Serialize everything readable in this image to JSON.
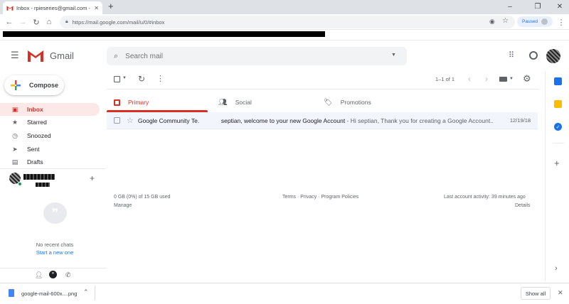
{
  "browser": {
    "tab_title": "Inbox - rpieseries@gmail.com - G",
    "url": "https://mail.google.com/mail/u/0/#inbox",
    "profile_status": "Paused",
    "new_tab_label": "+"
  },
  "gmail": {
    "logo_text": "Gmail",
    "search_placeholder": "Search mail",
    "compose_label": "Compose",
    "nav": [
      {
        "label": "Inbox",
        "icon": "inbox-icon"
      },
      {
        "label": "Starred",
        "icon": "star-icon"
      },
      {
        "label": "Snoozed",
        "icon": "clock-icon"
      },
      {
        "label": "Sent",
        "icon": "send-icon"
      },
      {
        "label": "Drafts",
        "icon": "draft-icon"
      }
    ],
    "hangouts": {
      "no_recent": "No recent chats",
      "start_new": "Start a new one"
    },
    "toolbar": {
      "pagination": "1–1 of 1"
    },
    "categories": [
      {
        "label": "Primary",
        "icon": "inbox-tab-icon"
      },
      {
        "label": "Social",
        "icon": "people-icon"
      },
      {
        "label": "Promotions",
        "icon": "tag-icon"
      }
    ],
    "emails": [
      {
        "sender": "Google Community Te.",
        "subject": "septian, welcome to your new Google Account",
        "snippet": " - Hi septian, Thank you for creating a Google Account...",
        "date": "12/19/18"
      }
    ],
    "footer": {
      "storage": "0 GB (0%) of 15 GB used",
      "manage": "Manage",
      "links": "Terms · Privacy · Program Policies",
      "activity": "Last account activity: 39 minutes ago",
      "details": "Details"
    }
  },
  "download_bar": {
    "filename": "google-mail-600x....png",
    "show_all": "Show all"
  },
  "colors": {
    "gmail_red": "#d93025",
    "accent_blue": "#1a73e8",
    "active_nav_bg": "#fce8e6"
  }
}
